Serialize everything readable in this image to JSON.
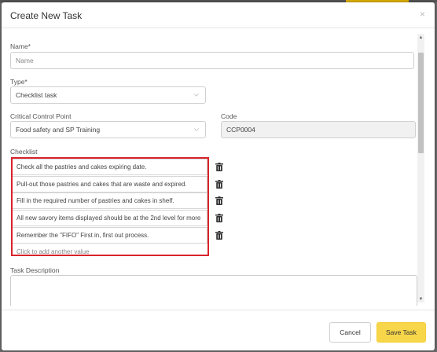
{
  "modal": {
    "title": "Create New Task",
    "close_glyph": "×"
  },
  "form": {
    "name_label": "Name*",
    "name_placeholder": "Name",
    "type_label": "Type*",
    "type_value": "Checklist task",
    "ccp_label": "Critical Control Point",
    "ccp_value": "Food safety and SP Training",
    "code_label": "Code",
    "code_value": "CCP0004",
    "checklist_label": "Checklist",
    "checklist_items": [
      "Check all the pastries and cakes expiring date.",
      "Pull-out those pastries and cakes that are waste and expired.",
      "Fill in the required number of pastries and cakes in shelf.",
      "All new savory items displayed should be at the 2nd level for more",
      "Remember the \"FIFO\" First in, first out process."
    ],
    "add_value_text": "Click to add another value",
    "description_label": "Task Description",
    "description_value": ""
  },
  "footer": {
    "cancel_label": "Cancel",
    "save_label": "Save Task"
  },
  "colors": {
    "highlight_border": "#d8232a",
    "save_button": "#f7d64a"
  }
}
